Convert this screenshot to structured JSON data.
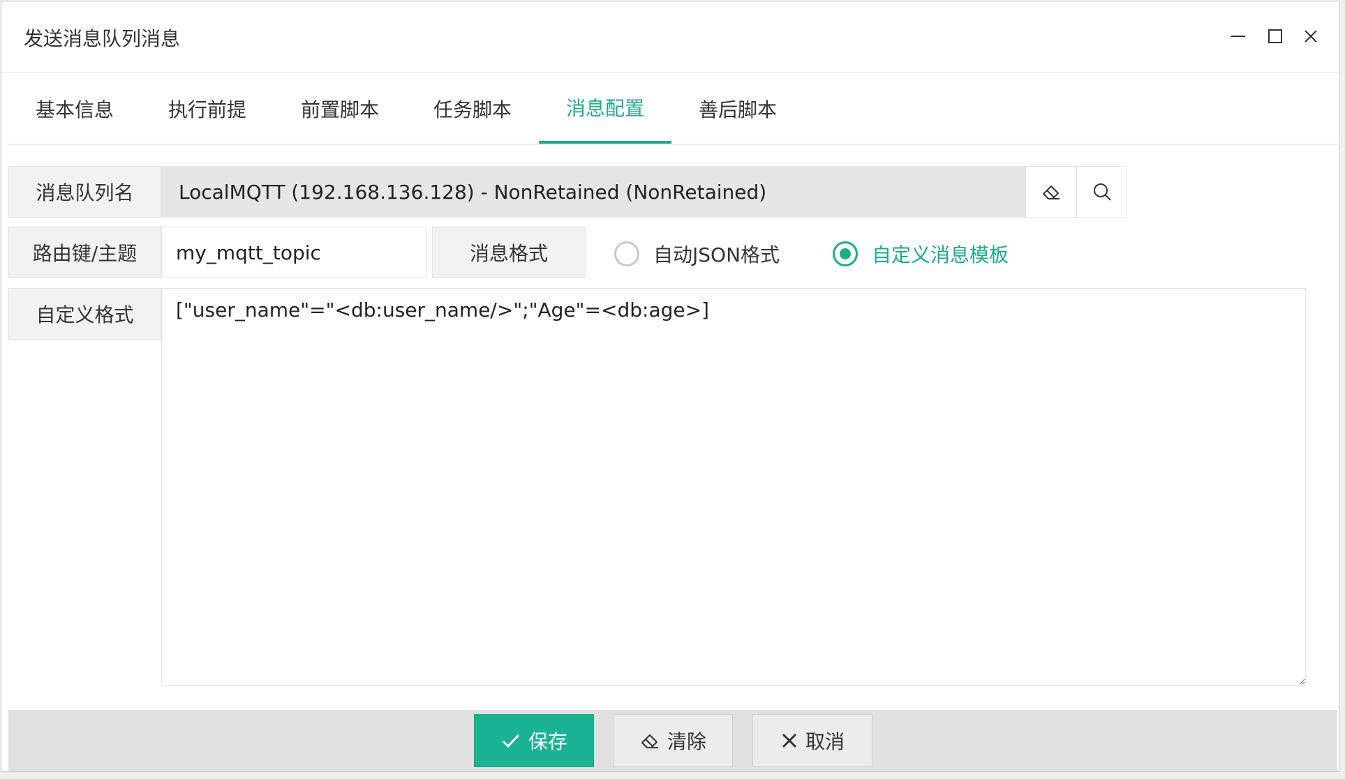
{
  "window": {
    "title": "发送消息队列消息"
  },
  "tabs": [
    {
      "label": "基本信息"
    },
    {
      "label": "执行前提"
    },
    {
      "label": "前置脚本"
    },
    {
      "label": "任务脚本"
    },
    {
      "label": "消息配置",
      "active": true
    },
    {
      "label": "善后脚本"
    }
  ],
  "form": {
    "queue_label": "消息队列名",
    "queue_value": "LocalMQTT (192.168.136.128) - NonRetained (NonRetained)",
    "routing_label": "路由键/主题",
    "routing_value": "my_mqtt_topic",
    "format_label": "消息格式",
    "format_options": [
      {
        "label": "自动JSON格式",
        "checked": false
      },
      {
        "label": "自定义消息模板",
        "checked": true
      }
    ],
    "custom_label": "自定义格式",
    "custom_value": "[\"user_name\"=\"<db:user_name/>\";\"Age\"=<db:age>]"
  },
  "footer": {
    "save_label": "保存",
    "clear_label": "清除",
    "cancel_label": "取消"
  },
  "colors": {
    "accent": "#1aad8c",
    "save_button": "#1ab394"
  },
  "icons": {
    "clear_field": "eraser-icon",
    "search_field": "search-icon",
    "save": "check-icon",
    "clear": "eraser-icon",
    "cancel": "close-icon"
  }
}
